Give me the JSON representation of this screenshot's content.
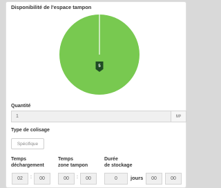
{
  "panel": {
    "title": "Disponibilité de l'espace tampon"
  },
  "chart_data": {
    "type": "pie",
    "slices": [
      {
        "label": "",
        "value": 100,
        "color": "#78c950"
      }
    ],
    "marker_label": "5",
    "marker_color": "#1f4a24"
  },
  "quantity": {
    "label": "Quantité",
    "value": "1",
    "unit": "M³"
  },
  "packaging": {
    "label": "Type de colisage",
    "button_label": "Spécifique"
  },
  "times": {
    "unloading": {
      "label_line1": "Temps",
      "label_line2": "déchargement",
      "hours": "02",
      "minutes": "00"
    },
    "buffer": {
      "label_line1": "Temps",
      "label_line2": "zone tampon",
      "hours": "00",
      "minutes": "00"
    },
    "storage": {
      "label_line1": "Durée",
      "label_line2": "de stockage",
      "days": "0",
      "days_label": "jours",
      "hours": "00",
      "minutes": "00"
    }
  },
  "colors": {
    "pie_fill": "#78c950",
    "panel_bg": "#ffffff",
    "page_bg": "#d9d9d9"
  }
}
